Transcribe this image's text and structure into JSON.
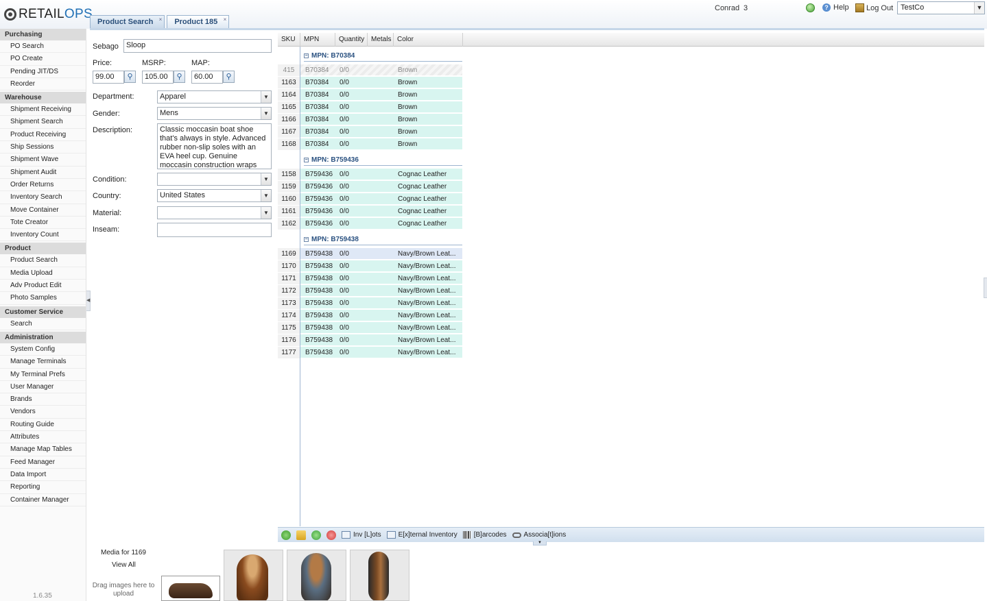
{
  "app": {
    "logo_text_a": "RETAIL",
    "logo_text_b": "OPS",
    "user": "Conrad",
    "user_count": "3",
    "help_label": "Help",
    "logout_label": "Log Out",
    "company": "TestCo",
    "version": "1.6.35"
  },
  "sidebar": {
    "purchasing": {
      "title": "Purchasing",
      "items": [
        "PO Search",
        "PO Create",
        "Pending JIT/DS",
        "Reorder"
      ]
    },
    "warehouse": {
      "title": "Warehouse",
      "items": [
        "Shipment Receiving",
        "Shipment Search",
        "Product Receiving",
        "Ship Sessions",
        "Shipment Wave",
        "Shipment Audit",
        "Order Returns",
        "Inventory Search",
        "Move Container",
        "Tote Creator",
        "Inventory Count"
      ]
    },
    "product": {
      "title": "Product",
      "items": [
        "Product Search",
        "Media Upload",
        "Adv Product Edit",
        "Photo Samples"
      ]
    },
    "customer_service": {
      "title": "Customer Service",
      "items": [
        "Search"
      ]
    },
    "administration": {
      "title": "Administration",
      "items": [
        "System Config",
        "Manage Terminals",
        "My Terminal Prefs",
        "User Manager",
        "Brands",
        "Vendors",
        "Routing Guide",
        "Attributes",
        "Manage Map Tables",
        "Feed Manager",
        "Data Import",
        "Reporting",
        "Container Manager"
      ]
    }
  },
  "tabs": [
    {
      "label": "Product Search",
      "close": "×"
    },
    {
      "label": "Product 185",
      "close": "×"
    }
  ],
  "form": {
    "brand": "Sebago",
    "name": "Sloop",
    "price_label": "Price:",
    "price": "99.00",
    "msrp_label": "MSRP:",
    "msrp": "105.00",
    "map_label": "MAP:",
    "map": "60.00",
    "department_label": "Department:",
    "department": "Apparel",
    "gender_label": "Gender:",
    "gender": "Mens",
    "description_label": "Description:",
    "description": "Classic moccasin boat shoe that's always in style. Advanced rubber non-slip soles with an EVA heel cup. Genuine moccasin construction wraps the foot in",
    "condition_label": "Condition:",
    "condition": "",
    "country_label": "Country:",
    "country": "United States",
    "material_label": "Material:",
    "material": "",
    "inseam_label": "Inseam:",
    "inseam": ""
  },
  "grid": {
    "columns": [
      "SKU",
      "MPN",
      "Quantity",
      "Metals",
      "Color"
    ],
    "groups": [
      {
        "title": "MPN: B70384",
        "rows": [
          {
            "sku": "415",
            "mpn": "B70384",
            "qty": "0/0",
            "color": "Brown",
            "state": "grey"
          },
          {
            "sku": "1163",
            "mpn": "B70384",
            "qty": "0/0",
            "color": "Brown",
            "state": ""
          },
          {
            "sku": "1164",
            "mpn": "B70384",
            "qty": "0/0",
            "color": "Brown",
            "state": ""
          },
          {
            "sku": "1165",
            "mpn": "B70384",
            "qty": "0/0",
            "color": "Brown",
            "state": ""
          },
          {
            "sku": "1166",
            "mpn": "B70384",
            "qty": "0/0",
            "color": "Brown",
            "state": ""
          },
          {
            "sku": "1167",
            "mpn": "B70384",
            "qty": "0/0",
            "color": "Brown",
            "state": ""
          },
          {
            "sku": "1168",
            "mpn": "B70384",
            "qty": "0/0",
            "color": "Brown",
            "state": ""
          }
        ]
      },
      {
        "title": "MPN: B759436",
        "rows": [
          {
            "sku": "1158",
            "mpn": "B759436",
            "qty": "0/0",
            "color": "Cognac Leather",
            "state": ""
          },
          {
            "sku": "1159",
            "mpn": "B759436",
            "qty": "0/0",
            "color": "Cognac Leather",
            "state": ""
          },
          {
            "sku": "1160",
            "mpn": "B759436",
            "qty": "0/0",
            "color": "Cognac Leather",
            "state": ""
          },
          {
            "sku": "1161",
            "mpn": "B759436",
            "qty": "0/0",
            "color": "Cognac Leather",
            "state": ""
          },
          {
            "sku": "1162",
            "mpn": "B759436",
            "qty": "0/0",
            "color": "Cognac Leather",
            "state": ""
          }
        ]
      },
      {
        "title": "MPN: B759438",
        "rows": [
          {
            "sku": "1169",
            "mpn": "B759438",
            "qty": "0/0",
            "color": "Navy/Brown Leat...",
            "state": "sel"
          },
          {
            "sku": "1170",
            "mpn": "B759438",
            "qty": "0/0",
            "color": "Navy/Brown Leat...",
            "state": ""
          },
          {
            "sku": "1171",
            "mpn": "B759438",
            "qty": "0/0",
            "color": "Navy/Brown Leat...",
            "state": ""
          },
          {
            "sku": "1172",
            "mpn": "B759438",
            "qty": "0/0",
            "color": "Navy/Brown Leat...",
            "state": ""
          },
          {
            "sku": "1173",
            "mpn": "B759438",
            "qty": "0/0",
            "color": "Navy/Brown Leat...",
            "state": ""
          },
          {
            "sku": "1174",
            "mpn": "B759438",
            "qty": "0/0",
            "color": "Navy/Brown Leat...",
            "state": ""
          },
          {
            "sku": "1175",
            "mpn": "B759438",
            "qty": "0/0",
            "color": "Navy/Brown Leat...",
            "state": ""
          },
          {
            "sku": "1176",
            "mpn": "B759438",
            "qty": "0/0",
            "color": "Navy/Brown Leat...",
            "state": ""
          },
          {
            "sku": "1177",
            "mpn": "B759438",
            "qty": "0/0",
            "color": "Navy/Brown Leat...",
            "state": ""
          }
        ]
      }
    ]
  },
  "toolbar": {
    "inv_lots": "Inv [L]ots",
    "external_inventory": "E[x]ternal Inventory",
    "barcodes": "[B]arcodes",
    "associations": "Associa[t]ions"
  },
  "media": {
    "label": "Media for 1169",
    "view_all": "View All",
    "drag_hint": "Drag images here to upload"
  },
  "colors": {
    "accent": "#2a5180",
    "row_bg": "#d8f5f0",
    "selected_row_bg": "#dfe8f6"
  }
}
